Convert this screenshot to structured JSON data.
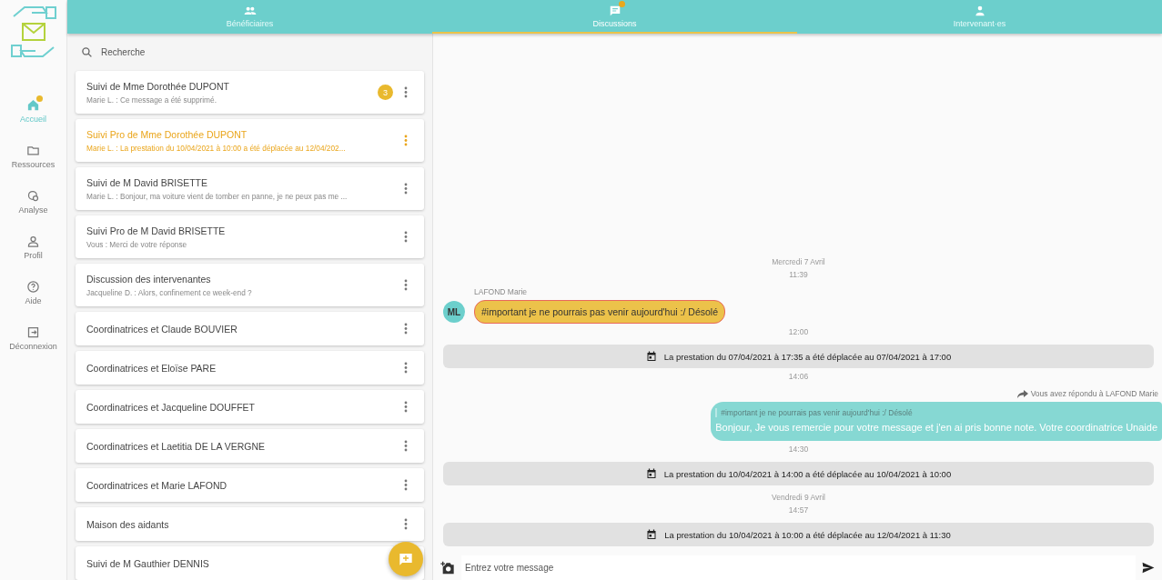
{
  "nav": {
    "items": [
      {
        "label": "Accueil",
        "selected": true,
        "badge": true
      },
      {
        "label": "Ressources",
        "selected": false,
        "badge": false
      },
      {
        "label": "Analyse",
        "selected": false,
        "badge": false
      },
      {
        "label": "Profil",
        "selected": false,
        "badge": false
      },
      {
        "label": "Aide",
        "selected": false,
        "badge": false
      },
      {
        "label": "Déconnexion",
        "selected": false,
        "badge": false
      }
    ]
  },
  "tabs": [
    {
      "label": "Bénéficiaires",
      "selected": false,
      "badge": false
    },
    {
      "label": "Discussions",
      "selected": true,
      "badge": true
    },
    {
      "label": "Intervenant·es",
      "selected": false,
      "badge": false
    }
  ],
  "search": {
    "placeholder": "Recherche"
  },
  "conversations": [
    {
      "title": "Suivi de Mme Dorothée DUPONT",
      "preview": "Marie L. : Ce message a été supprimé.",
      "unread": "3",
      "selected": false
    },
    {
      "title": "Suivi Pro de Mme Dorothée DUPONT",
      "preview": "Marie L. : La prestation du 10/04/2021 à 10:00 a été déplacée au 12/04/202...",
      "selected": true
    },
    {
      "title": "Suivi de M David BRISETTE",
      "preview": "Marie L. : Bonjour, ma voiture vient de tomber en panne, je ne peux pas me ...",
      "selected": false
    },
    {
      "title": "Suivi Pro de M David BRISETTE",
      "preview": "Vous : Merci de votre réponse",
      "selected": false
    },
    {
      "title": "Discussion des intervenantes",
      "preview": "Jacqueline D. : Alors, confinement ce week-end ?",
      "selected": false
    },
    {
      "title": "Coordinatrices et Claude BOUVIER",
      "selected": false
    },
    {
      "title": "Coordinatrices et Eloïse PARE",
      "selected": false
    },
    {
      "title": "Coordinatrices et Jacqueline DOUFFET",
      "selected": false
    },
    {
      "title": "Coordinatrices et Laetitia DE LA VERGNE",
      "selected": false
    },
    {
      "title": "Coordinatrices et Marie LAFOND",
      "selected": false
    },
    {
      "title": "Maison des aidants",
      "selected": false
    },
    {
      "title": "Suivi de M Gauthier DENNIS",
      "selected": false
    }
  ],
  "messages": [
    {
      "kind": "date",
      "text": "Mercredi 7 Avril"
    },
    {
      "kind": "time",
      "text": "11:39"
    },
    {
      "kind": "incoming",
      "author": "LAFOND Marie",
      "initials": "ML",
      "text": "#important je ne pourrais pas venir aujourd'hui :/ Désolé",
      "important": true
    },
    {
      "kind": "time",
      "text": "12:00"
    },
    {
      "kind": "event",
      "text": "La prestation du 07/04/2021 à 17:35 a été déplacée au 07/04/2021 à 17:00"
    },
    {
      "kind": "time",
      "text": "14:06"
    },
    {
      "kind": "outgoing",
      "reply_note": "Vous avez répondu à LAFOND Marie",
      "quote": "#important je ne pourrais pas venir aujourd'hui :/ Désolé",
      "text": "Bonjour, Je vous remercie pour votre message et j'en ai pris bonne note. Votre coordinatrice Unaide"
    },
    {
      "kind": "time",
      "text": "14:30"
    },
    {
      "kind": "event",
      "text": "La prestation du 10/04/2021 à 14:00 a été déplacée au 10/04/2021 à 10:00"
    },
    {
      "kind": "date",
      "text": "Vendredi 9 Avril"
    },
    {
      "kind": "time",
      "text": "14:57"
    },
    {
      "kind": "event",
      "text": "La prestation du 10/04/2021 à 10:00 a été déplacée au 12/04/2021 à 11:30"
    }
  ],
  "composer": {
    "placeholder": "Entrez votre message"
  }
}
